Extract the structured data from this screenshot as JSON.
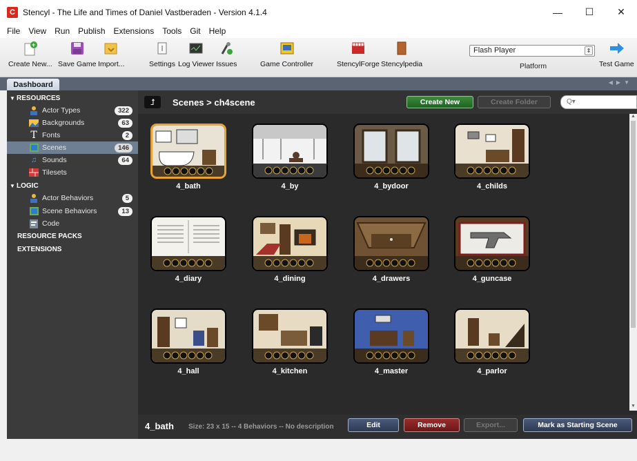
{
  "window": {
    "title": "Stencyl - The Life and Times of Daniel Vastberaden - Version 4.1.4",
    "app_icon": "C",
    "controls": {
      "minimize": "—",
      "maximize": "☐",
      "close": "✕"
    }
  },
  "menu": [
    "File",
    "View",
    "Run",
    "Publish",
    "Extensions",
    "Tools",
    "Git",
    "Help"
  ],
  "toolbar": {
    "create_new": "Create New...",
    "save_game": "Save Game",
    "import": "Import...",
    "settings": "Settings",
    "log_viewer": "Log Viewer",
    "issues": "Issues",
    "game_controller": "Game Controller",
    "stencylforge": "StencylForge",
    "stencylpedia": "Stencylpedia",
    "platform_value": "Flash Player",
    "platform_label": "Platform",
    "test_game": "Test Game"
  },
  "tabs": {
    "dashboard": "Dashboard"
  },
  "sidebar": {
    "resources_label": "RESOURCES",
    "resources": [
      {
        "label": "Actor Types",
        "count": "322",
        "icon": "actor-icon"
      },
      {
        "label": "Backgrounds",
        "count": "63",
        "icon": "backgrounds-icon"
      },
      {
        "label": "Fonts",
        "count": "2",
        "icon": "fonts-icon"
      },
      {
        "label": "Scenes",
        "count": "146",
        "icon": "scenes-icon"
      },
      {
        "label": "Sounds",
        "count": "64",
        "icon": "sounds-icon"
      },
      {
        "label": "Tilesets",
        "count": "",
        "icon": "tilesets-icon"
      }
    ],
    "logic_label": "LOGIC",
    "logic": [
      {
        "label": "Actor Behaviors",
        "count": "5",
        "icon": "actor-behaviors-icon"
      },
      {
        "label": "Scene Behaviors",
        "count": "13",
        "icon": "scene-behaviors-icon"
      },
      {
        "label": "Code",
        "count": "",
        "icon": "code-icon"
      }
    ],
    "resource_packs": "RESOURCE PACKS",
    "extensions": "EXTENSIONS",
    "selected": "Scenes"
  },
  "content": {
    "breadcrumb": "Scenes > ch4scene",
    "create_new": "Create New",
    "create_folder": "Create Folder",
    "search_placeholder": "Q▾",
    "scenes": [
      "4_bath",
      "4_by",
      "4_bydoor",
      "4_childs",
      "4_diary",
      "4_dining",
      "4_drawers",
      "4_guncase",
      "4_hall",
      "4_kitchen",
      "4_master",
      "4_parlor"
    ],
    "selected_scene": "4_bath"
  },
  "status": {
    "name": "4_bath",
    "info": "Size: 23 x 15 -- 4 Behaviors -- No description",
    "edit": "Edit",
    "remove": "Remove",
    "export": "Export...",
    "mark_start": "Mark as Starting Scene"
  },
  "colors": {
    "accent_selected": "#e9a233",
    "create_green": "#2e7d32",
    "remove_red": "#8a2323",
    "sidebar_bg": "#3b3b3b",
    "content_bg": "#2a2a2a"
  }
}
